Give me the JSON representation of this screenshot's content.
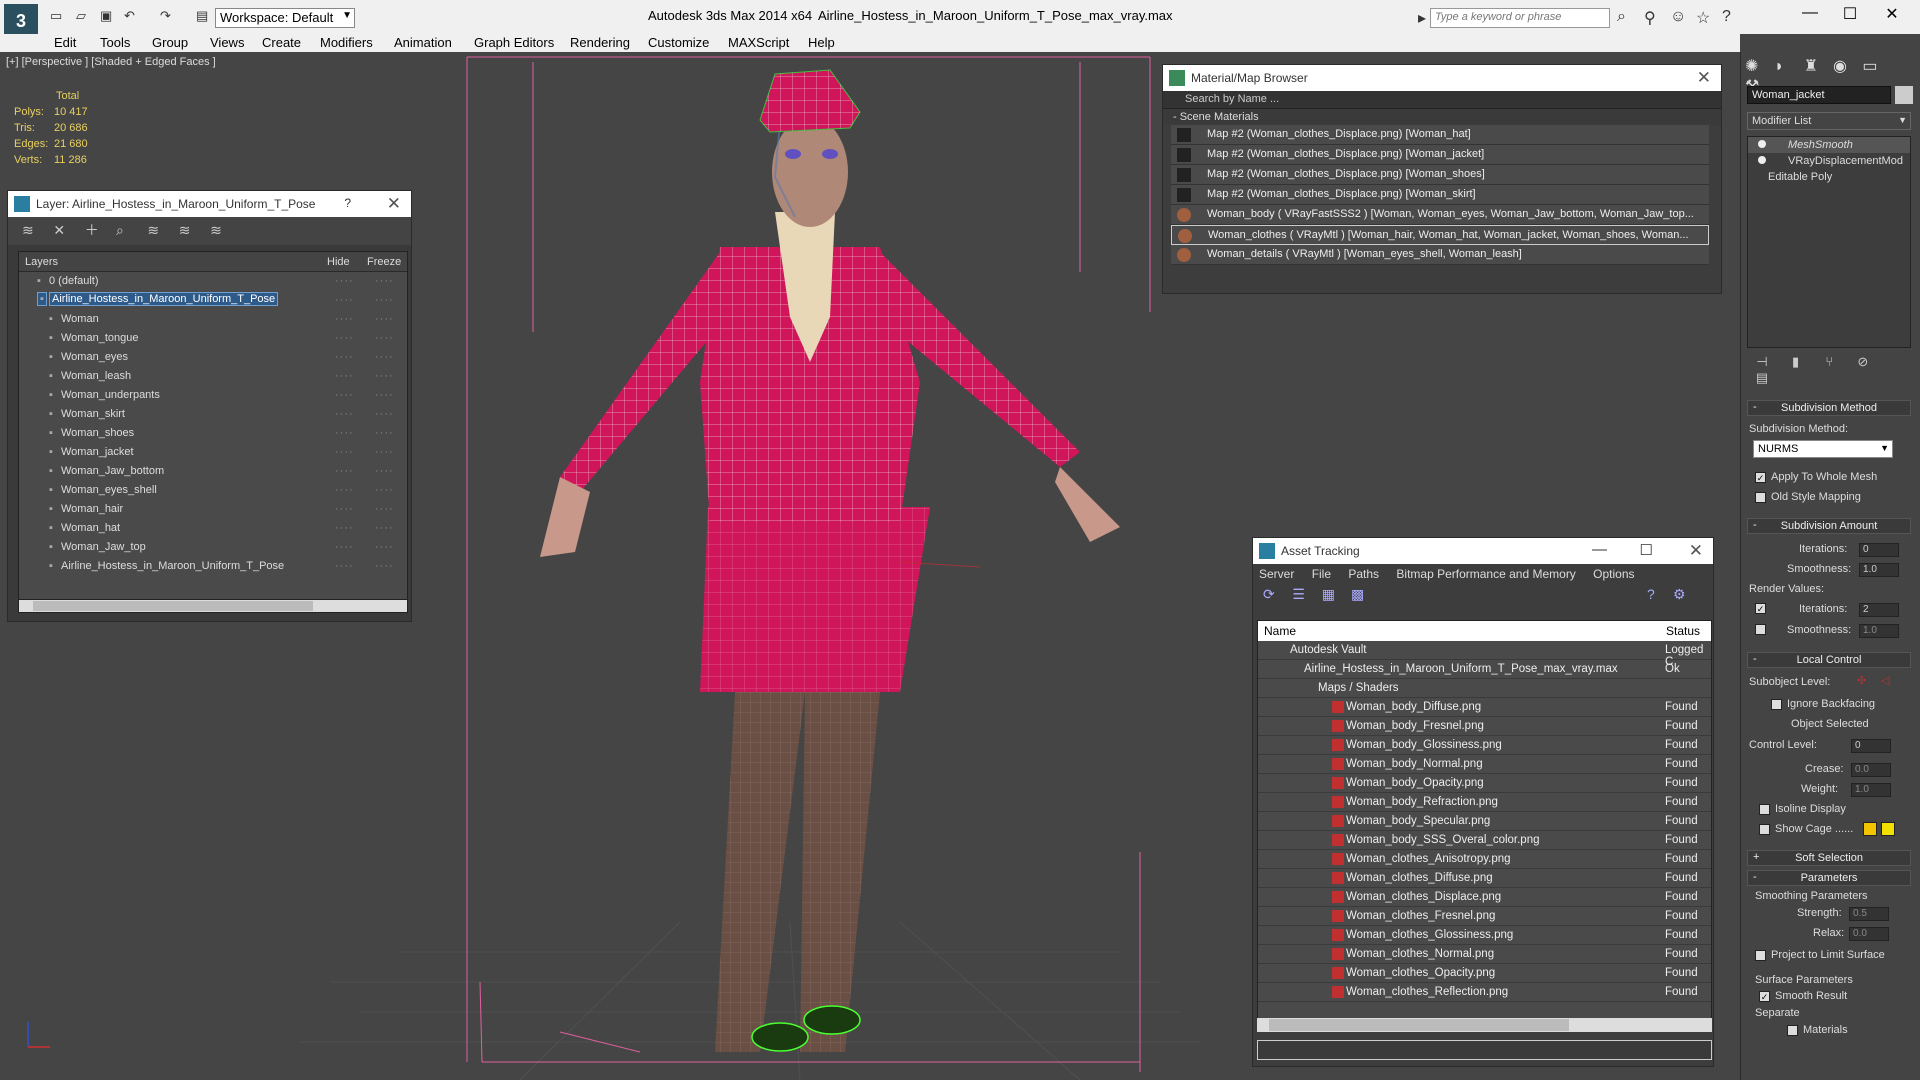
{
  "titlebar": {
    "workspace_label": "Workspace: Default",
    "app_title": "Autodesk 3ds Max  2014 x64",
    "doc_title": "Airline_Hostess_in_Maroon_Uniform_T_Pose_max_vray.max",
    "search_placeholder": "Type a keyword or phrase"
  },
  "menu": [
    "Edit",
    "Tools",
    "Group",
    "Views",
    "Create",
    "Modifiers",
    "Animation",
    "Graph Editors",
    "Rendering",
    "Customize",
    "MAXScript",
    "Help"
  ],
  "viewport": {
    "label": "[+] [Perspective ] [Shaded + Edged Faces ]",
    "stats_header": "Total",
    "stats": [
      {
        "key": "Polys:",
        "value": "10 417"
      },
      {
        "key": "Tris:",
        "value": "20 686"
      },
      {
        "key": "Edges:",
        "value": "21 680"
      },
      {
        "key": "Verts:",
        "value": "11 286"
      }
    ]
  },
  "layer_panel": {
    "title": "Layer: Airline_Hostess_in_Maroon_Uniform_T_Pose",
    "help": "?",
    "columns": {
      "layers": "Layers",
      "hide": "Hide",
      "freeze": "Freeze"
    },
    "rows": [
      {
        "name": "0 (default)",
        "indent": 0
      },
      {
        "name": "Airline_Hostess_in_Maroon_Uniform_T_Pose",
        "indent": 0
      },
      {
        "name": "Woman",
        "indent": 1
      },
      {
        "name": "Woman_tongue",
        "indent": 1
      },
      {
        "name": "Woman_eyes",
        "indent": 1
      },
      {
        "name": "Woman_leash",
        "indent": 1
      },
      {
        "name": "Woman_underpants",
        "indent": 1
      },
      {
        "name": "Woman_skirt",
        "indent": 1
      },
      {
        "name": "Woman_shoes",
        "indent": 1
      },
      {
        "name": "Woman_jacket",
        "indent": 1
      },
      {
        "name": "Woman_Jaw_bottom",
        "indent": 1
      },
      {
        "name": "Woman_eyes_shell",
        "indent": 1
      },
      {
        "name": "Woman_hair",
        "indent": 1
      },
      {
        "name": "Woman_hat",
        "indent": 1
      },
      {
        "name": "Woman_Jaw_top",
        "indent": 1
      },
      {
        "name": "Airline_Hostess_in_Maroon_Uniform_T_Pose",
        "indent": 1
      }
    ]
  },
  "material_browser": {
    "title": "Material/Map Browser",
    "search_placeholder": "Search by Name ...",
    "section": "- Scene Materials",
    "rows": [
      "Map #2 (Woman_clothes_Displace.png)  [Woman_hat]",
      "Map #2 (Woman_clothes_Displace.png)  [Woman_jacket]",
      "Map #2 (Woman_clothes_Displace.png)  [Woman_shoes]",
      "Map #2 (Woman_clothes_Displace.png)  [Woman_skirt]",
      "Woman_body  ( VRayFastSSS2 )  [Woman, Woman_eyes, Woman_Jaw_bottom, Woman_Jaw_top...",
      "Woman_clothes  ( VRayMtl )  [Woman_hair, Woman_hat, Woman_jacket, Woman_shoes, Woman...",
      "Woman_details  ( VRayMtl )  [Woman_eyes_shell, Woman_leash]"
    ]
  },
  "asset_tracking": {
    "title": "Asset Tracking",
    "menu": [
      "Server",
      "File",
      "Paths",
      "Bitmap Performance and Memory",
      "Options"
    ],
    "columns": {
      "name": "Name",
      "status": "Status"
    },
    "rows": [
      {
        "name": "Autodesk Vault",
        "status": "Logged C",
        "level": 1
      },
      {
        "name": "Airline_Hostess_in_Maroon_Uniform_T_Pose_max_vray.max",
        "status": "Ok",
        "level": 2
      },
      {
        "name": "Maps / Shaders",
        "status": "",
        "level": 3
      },
      {
        "name": "Woman_body_Diffuse.png",
        "status": "Found",
        "level": 4
      },
      {
        "name": "Woman_body_Fresnel.png",
        "status": "Found",
        "level": 4
      },
      {
        "name": "Woman_body_Glossiness.png",
        "status": "Found",
        "level": 4
      },
      {
        "name": "Woman_body_Normal.png",
        "status": "Found",
        "level": 4
      },
      {
        "name": "Woman_body_Opacity.png",
        "status": "Found",
        "level": 4
      },
      {
        "name": "Woman_body_Refraction.png",
        "status": "Found",
        "level": 4
      },
      {
        "name": "Woman_body_Specular.png",
        "status": "Found",
        "level": 4
      },
      {
        "name": "Woman_body_SSS_Overal_color.png",
        "status": "Found",
        "level": 4
      },
      {
        "name": "Woman_clothes_Anisotropy.png",
        "status": "Found",
        "level": 4
      },
      {
        "name": "Woman_clothes_Diffuse.png",
        "status": "Found",
        "level": 4
      },
      {
        "name": "Woman_clothes_Displace.png",
        "status": "Found",
        "level": 4
      },
      {
        "name": "Woman_clothes_Fresnel.png",
        "status": "Found",
        "level": 4
      },
      {
        "name": "Woman_clothes_Glossiness.png",
        "status": "Found",
        "level": 4
      },
      {
        "name": "Woman_clothes_Normal.png",
        "status": "Found",
        "level": 4
      },
      {
        "name": "Woman_clothes_Opacity.png",
        "status": "Found",
        "level": 4
      },
      {
        "name": "Woman_clothes_Reflection.png",
        "status": "Found",
        "level": 4
      }
    ]
  },
  "command_panel": {
    "object_name": "Woman_jacket",
    "modifier_list": "Modifier List",
    "stack": [
      "MeshSmooth",
      "VRayDisplacementMod",
      "Editable Poly"
    ],
    "subdivision_method_title": "Subdivision Method",
    "subdivision_method_label": "Subdivision Method:",
    "subdivision_method_value": "NURMS",
    "apply_whole_mesh": "Apply To Whole Mesh",
    "old_style_mapping": "Old Style Mapping",
    "subdivision_amount_title": "Subdivision Amount",
    "iterations_label": "Iterations:",
    "iterations_value": "0",
    "smoothness_label": "Smoothness:",
    "smoothness_value": "1.0",
    "render_values_label": "Render Values:",
    "render_iterations_label": "Iterations:",
    "render_iterations_value": "2",
    "render_smoothness_label": "Smoothness:",
    "render_smoothness_value": "1.0",
    "local_control_title": "Local Control",
    "subobject_level_label": "Subobject Level:",
    "ignore_backfacing": "Ignore Backfacing",
    "object_selected": "Object Selected",
    "control_level_label": "Control Level:",
    "control_level_value": "0",
    "crease_label": "Crease:",
    "crease_value": "0.0",
    "weight_label": "Weight:",
    "weight_value": "1.0",
    "isoline_display": "Isoline Display",
    "show_cage": "Show Cage ......",
    "cage_colors": [
      "#f2c500",
      "#f2e000"
    ],
    "soft_selection_title": "Soft Selection",
    "parameters_title": "Parameters",
    "smoothing_parameters": "Smoothing Parameters",
    "strength_label": "Strength:",
    "strength_value": "0.5",
    "relax_label": "Relax:",
    "relax_value": "0.0",
    "project_limit": "Project to Limit Surface",
    "surface_parameters": "Surface Parameters",
    "smooth_result": "Smooth Result",
    "separate": "Separate",
    "materials": "Materials"
  }
}
